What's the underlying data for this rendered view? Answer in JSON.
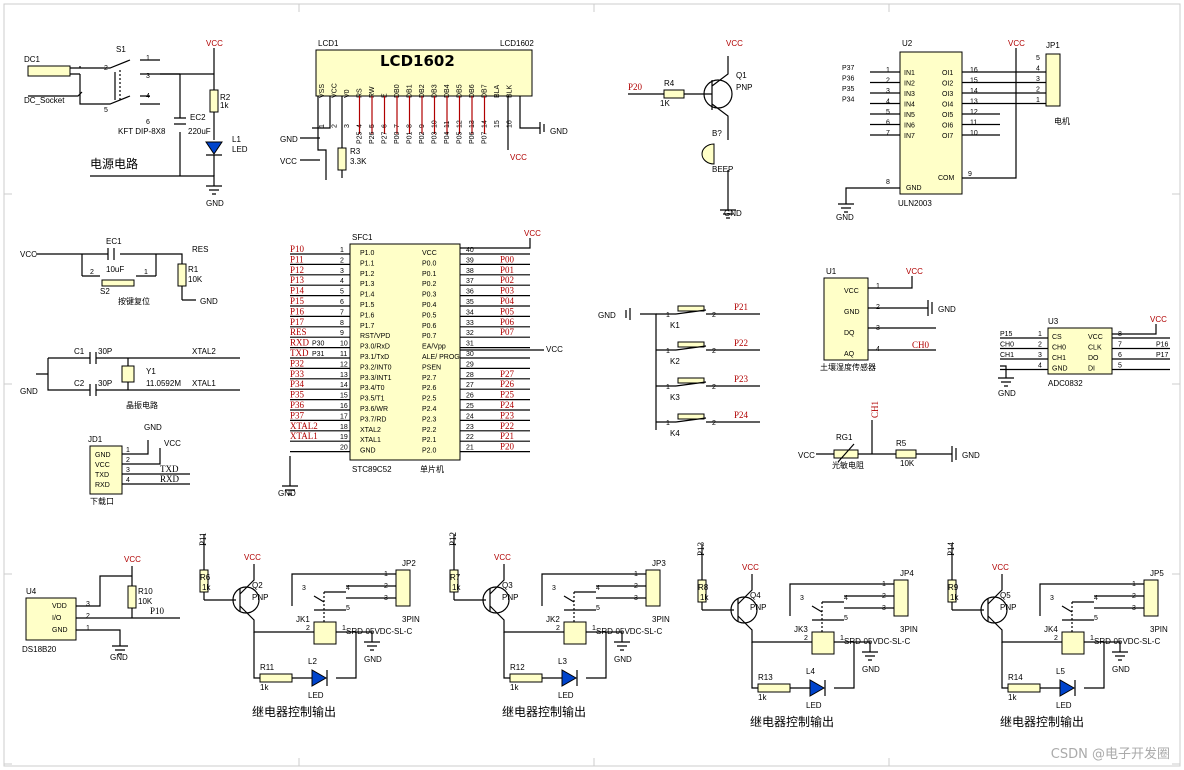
{
  "power": {
    "dc_ref": "DC1",
    "dc_name": "DC_Socket",
    "s1_ref": "S1",
    "s1_name": "KFT DIP-8X8",
    "ec2_ref": "EC2",
    "ec2_val": "220uF",
    "r2_ref": "R2",
    "r2_val": "1k",
    "l1_ref": "L1",
    "l1_name": "LED",
    "vcc": "VCC",
    "gnd": "GND",
    "label": "电源电路",
    "pins": [
      "1",
      "2",
      "3",
      "4",
      "5",
      "6"
    ]
  },
  "lcd": {
    "ref": "LCD1",
    "part": "LCD1602",
    "title": "LCD1602",
    "pins": [
      "VSS",
      "VCC",
      "V0",
      "RS",
      "RW",
      "E",
      "DB0",
      "DB1",
      "DB2",
      "DB3",
      "DB4",
      "DB5",
      "DB6",
      "DB7",
      "BLA",
      "BLK"
    ],
    "nums": [
      "1",
      "2",
      "3",
      "4",
      "5",
      "6",
      "7",
      "8",
      "9",
      "10",
      "11",
      "12",
      "13",
      "14",
      "15",
      "16"
    ],
    "nets": [
      "P25",
      "P26",
      "P27",
      "P00",
      "P01",
      "P02",
      "P03",
      "P04",
      "P05",
      "P06",
      "P07"
    ],
    "r3_ref": "R3",
    "r3_val": "3.3K",
    "gnd": "GND",
    "vcc": "VCC"
  },
  "buzzer": {
    "net": "P20",
    "r_ref": "R4",
    "r_val": "1K",
    "q_ref": "Q1",
    "q_type": "PNP",
    "b_ref": "B?",
    "b_name": "BEEP",
    "vcc": "VCC",
    "gnd": "GND"
  },
  "uln": {
    "ref": "U2",
    "part": "ULN2003",
    "in_nets": [
      "P37",
      "P36",
      "P35",
      "P34"
    ],
    "in_pins": [
      "IN1",
      "IN2",
      "IN3",
      "IN4",
      "IN5",
      "IN6",
      "IN7"
    ],
    "out_pins": [
      "OI1",
      "OI2",
      "OI3",
      "OI4",
      "OI5",
      "OI6",
      "OI7"
    ],
    "in_nums": [
      "1",
      "2",
      "3",
      "4",
      "5",
      "6",
      "7"
    ],
    "out_nums": [
      "16",
      "15",
      "14",
      "13",
      "12",
      "11",
      "10"
    ],
    "gnd_pin": "GND",
    "com_pin": "COM",
    "gnd_num": "8",
    "com_num": "9",
    "jp_ref": "JP1",
    "motor": "电机",
    "jp_nums": [
      "5",
      "4",
      "3",
      "2",
      "1"
    ],
    "vcc": "VCC",
    "gnd": "GND"
  },
  "reset": {
    "vcc": "VCC",
    "ec_ref": "EC1",
    "ec_val": "10uF",
    "s_ref": "S2",
    "label": "按键复位",
    "r_ref": "R1",
    "r_val": "10K",
    "net": "RES",
    "gnd": "GND",
    "pins": [
      "2",
      "1"
    ]
  },
  "crystal": {
    "c1_ref": "C1",
    "c1_val": "30P",
    "c2_ref": "C2",
    "c2_val": "30P",
    "y_ref": "Y1",
    "y_val": "11.0592M",
    "label": "晶振电路",
    "n1": "XTAL2",
    "n2": "XTAL1",
    "gnd": "GND"
  },
  "prog": {
    "ref": "JD1",
    "pins": [
      "GND",
      "VCC",
      "TXD",
      "RXD"
    ],
    "nums": [
      "1",
      "2",
      "3",
      "4"
    ],
    "nets": [
      "TXD",
      "RXD"
    ],
    "label": "下载口",
    "gnd": "GND",
    "vcc": "VCC"
  },
  "mcu": {
    "ref": "SFC1",
    "part": "STC89C52",
    "label": "单片机",
    "left_pins": [
      "P1.0",
      "P1.1",
      "P1.2",
      "P1.3",
      "P1.4",
      "P1.5",
      "P1.6",
      "P1.7",
      "RST/VPD",
      "P3.0/RxD",
      "P3.1/TxD",
      "P3.2/INT0",
      "P3.3/INT1",
      "P3.4/T0",
      "P3.5/T1",
      "P3.6/WR",
      "P3.7/RD",
      "XTAL2",
      "XTAL1",
      "GND"
    ],
    "left_nums": [
      "1",
      "2",
      "3",
      "4",
      "5",
      "6",
      "7",
      "8",
      "9",
      "10",
      "11",
      "12",
      "13",
      "14",
      "15",
      "16",
      "17",
      "18",
      "19",
      "20"
    ],
    "left_nets": [
      "P10",
      "P11",
      "P12",
      "P13",
      "P14",
      "P15",
      "P16",
      "P17",
      "RES",
      "RXD",
      "TXD",
      "P32",
      "P33",
      "P34",
      "P35",
      "P36",
      "P37",
      "XTAL2",
      "XTAL1",
      ""
    ],
    "left_sub": [
      "",
      "",
      "",
      "",
      "",
      "",
      "",
      "",
      "",
      "P30",
      "P31",
      "",
      "",
      "",
      "",
      "",
      "",
      "",
      "",
      ""
    ],
    "right_pins": [
      "VCC",
      "P0.0",
      "P0.1",
      "P0.2",
      "P0.3",
      "P0.4",
      "P0.5",
      "P0.6",
      "P0.7",
      "EA/Vpp",
      "ALE/ PROG",
      "PSEN",
      "P2.7",
      "P2.6",
      "P2.5",
      "P2.4",
      "P2.3",
      "P2.2",
      "P2.1",
      "P2.0"
    ],
    "right_nums": [
      "40",
      "39",
      "38",
      "37",
      "36",
      "35",
      "34",
      "33",
      "32",
      "31",
      "30",
      "29",
      "28",
      "27",
      "26",
      "25",
      "24",
      "23",
      "22",
      "21"
    ],
    "right_nets": [
      "",
      "P00",
      "P01",
      "P02",
      "P03",
      "P04",
      "P05",
      "P06",
      "P07",
      "",
      "",
      "",
      "P27",
      "P26",
      "P25",
      "P24",
      "P23",
      "P22",
      "P21",
      "P20"
    ],
    "vcc": "VCC",
    "gnd": "GND"
  },
  "keys": {
    "refs": [
      "K1",
      "K2",
      "K3",
      "K4"
    ],
    "nets": [
      "P21",
      "P22",
      "P23",
      "P24"
    ],
    "pins": [
      "1",
      "2"
    ],
    "gnd": "GND"
  },
  "temp_sensor": {
    "ref": "U1",
    "pins": [
      "VCC",
      "GND",
      "DQ",
      "AQ"
    ],
    "nums": [
      "1",
      "2",
      "3",
      "4"
    ],
    "net": "CH0",
    "label": "土壤湿度传感器",
    "vcc": "VCC",
    "gnd": "GND"
  },
  "light": {
    "net": "CH1",
    "rg_ref": "RG1",
    "rg_label": "光敏电阻",
    "r_ref": "R5",
    "r_val": "10K",
    "vcc": "VCC",
    "gnd": "GND"
  },
  "adc": {
    "ref": "U3",
    "part": "ADC0832",
    "left_pins": [
      "CS",
      "CH0",
      "CH1",
      "GND"
    ],
    "left_nums": [
      "1",
      "2",
      "3",
      "4"
    ],
    "left_nets": [
      "P15",
      "CH0",
      "CH1",
      ""
    ],
    "right_pins": [
      "VCC",
      "CLK",
      "DO",
      "DI"
    ],
    "right_nums": [
      "8",
      "7",
      "6",
      "5"
    ],
    "right_nets": [
      "",
      "P16",
      "P17",
      ""
    ],
    "vcc": "VCC",
    "gnd": "GND"
  },
  "ds18b20": {
    "ref": "U4",
    "part": "DS18B20",
    "pins": [
      "VDD",
      "I/O",
      "GND"
    ],
    "nums": [
      "3",
      "2",
      "1"
    ],
    "r_ref": "R10",
    "r_val": "10K",
    "net": "P10",
    "vcc": "VCC",
    "gnd": "GND"
  },
  "relays": [
    {
      "net": "P11",
      "r_ref": "R6",
      "r_val": "1k",
      "q_ref": "Q2",
      "jk_ref": "JK1",
      "jp_ref": "JP2",
      "r2_ref": "R11",
      "r2_val": "1k",
      "led_ref": "L2"
    },
    {
      "net": "P12",
      "r_ref": "R7",
      "r_val": "1k",
      "q_ref": "Q3",
      "jk_ref": "JK2",
      "jp_ref": "JP3",
      "r2_ref": "R12",
      "r2_val": "1k",
      "led_ref": "L3"
    },
    {
      "net": "P13",
      "r_ref": "R8",
      "r_val": "1k",
      "q_ref": "Q4",
      "jk_ref": "JK3",
      "jp_ref": "JP4",
      "r2_ref": "R13",
      "r2_val": "1k",
      "led_ref": "L4"
    },
    {
      "net": "P14",
      "r_ref": "R9",
      "r_val": "1k",
      "q_ref": "Q5",
      "jk_ref": "JK4",
      "jp_ref": "JP5",
      "r2_ref": "R14",
      "r2_val": "1k",
      "led_ref": "L5"
    }
  ],
  "relay_common": {
    "q_type": "PNP",
    "relay_part": "SRD-05VDC-SL-C",
    "jp_part": "3PIN",
    "led": "LED",
    "label": "继电器控制输出",
    "vcc": "VCC",
    "gnd": "GND",
    "coil_pins": [
      "1",
      "2"
    ],
    "contact_pins": [
      "3",
      "4",
      "5"
    ],
    "jp_pins": [
      "1",
      "2",
      "3"
    ]
  },
  "watermark": "CSDN @电子开发圈"
}
